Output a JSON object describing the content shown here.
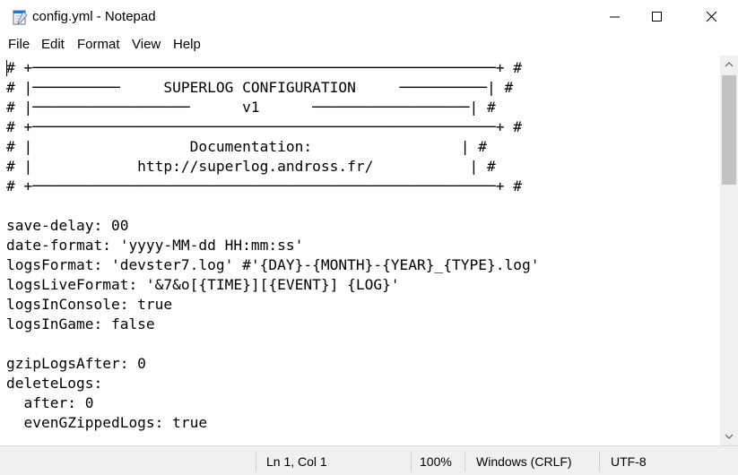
{
  "window": {
    "title": "config.yml - Notepad",
    "icon": "notepad-icon"
  },
  "menu": {
    "file": "File",
    "edit": "Edit",
    "format": "Format",
    "view": "View",
    "help": "Help"
  },
  "editor": {
    "lines": [
      "# +─────────────────────────────────────────────────────+ #",
      "# |──────────     SUPERLOG CONFIGURATION     ──────────| #",
      "# |──────────────────      v1      ──────────────────| #",
      "# +─────────────────────────────────────────────────────+ #",
      "# |                  Documentation:                 | #",
      "# |            http://superlog.andross.fr/           | #",
      "# +─────────────────────────────────────────────────────+ #",
      "",
      "save-delay: 00",
      "date-format: 'yyyy-MM-dd HH:mm:ss'",
      "logsFormat: 'devster7.log' #'{DAY}-{MONTH}-{YEAR}_{TYPE}.log'",
      "logsLiveFormat: '&7&o[{TIME}][{EVENT}] {LOG}'",
      "logsInConsole: true",
      "logsInGame: false",
      "",
      "gzipLogsAfter: 0",
      "deleteLogs:",
      "  after: 0",
      "  evenGZippedLogs: true"
    ]
  },
  "status": {
    "position": "Ln 1, Col 1",
    "zoom": "100%",
    "line_ending": "Windows (CRLF)",
    "encoding": "UTF-8"
  },
  "colors": {
    "status_bg": "#f0f0f0",
    "scrollbar_bg": "#f0f0f0",
    "scroll_thumb": "#c2c2c2",
    "icon_blue": "#1b7bd0"
  }
}
